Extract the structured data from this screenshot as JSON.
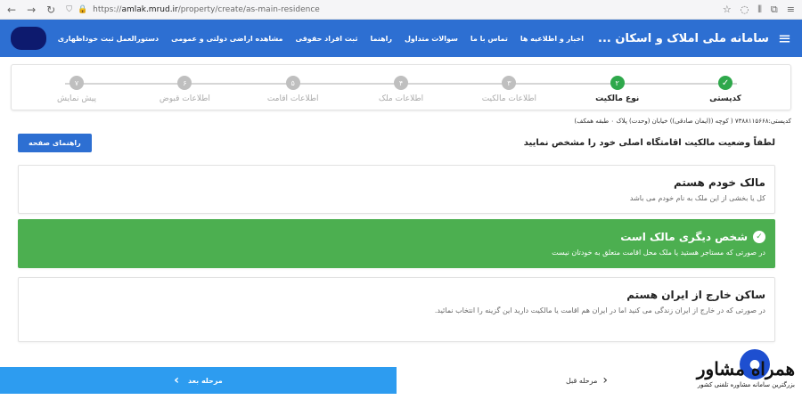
{
  "browser": {
    "url_prefix": "https://",
    "url_host": "amlak.mrud.ir",
    "url_path": "/property/create/as-main-residence"
  },
  "nav": {
    "title": "سامانه ملی املاک و اسکان ...",
    "links": [
      "اخبار و اطلاعیه ها",
      "تماس با ما",
      "سوالات متداول",
      "راهنما",
      "ثبت افراد حقوقی",
      "مشاهده اراضی دولتی و عمومی",
      "دستورالعمل ثبت خوداظهاری"
    ]
  },
  "stepper": {
    "steps": [
      {
        "num": "✓",
        "label": "کدپستی",
        "state": "done"
      },
      {
        "num": "۲",
        "label": "نوع مالکیت",
        "state": "active"
      },
      {
        "num": "۳",
        "label": "اطلاعات مالکیت",
        "state": "todo"
      },
      {
        "num": "۴",
        "label": "اطلاعات ملک",
        "state": "todo"
      },
      {
        "num": "۵",
        "label": "اطلاعات اقامت",
        "state": "todo"
      },
      {
        "num": "۶",
        "label": "اطلاعات قبوض",
        "state": "todo"
      },
      {
        "num": "۷",
        "label": "پیش نمایش",
        "state": "todo"
      }
    ]
  },
  "postal_line": "کدپستی:۷۳۸۸۱۱۵۶۶۸ ( کوچه ((ایمان صادقی)) خیابان (وحدت) پلاک ۰ طبقه همکف)",
  "question": "لطفاً وضعیت مالکیت اقامتگاه اصلی خود را مشخص نمایید",
  "help_button": "راهنمای صفحه",
  "options": [
    {
      "title": "مالک خودم هستم",
      "desc": "کل یا بخشی از این ملک به نام خودم می باشد",
      "selected": false
    },
    {
      "title": "شخص دیگری مالک است",
      "desc": "در صورتی که مستاجر هستید یا ملک محل اقامت متعلق به خودتان نیست",
      "selected": true
    },
    {
      "title": "ساکن خارج از ایران هستم",
      "desc": "در صورتی که در خارج از ایران زندگی می کنید اما در ایران هم اقامت یا مالکیت دارید این گزینه را انتخاب نمائید.",
      "selected": false
    }
  ],
  "buttons": {
    "next": "مرحله بعد",
    "prev": "مرحله قبل"
  },
  "brand": {
    "name": "همراه مشاور",
    "tagline": "بزرگترین سامانه مشاوره تلفنی کشور"
  },
  "colors": {
    "primary": "#2d6fd2",
    "selected": "#4caf50",
    "next": "#2d9cf0"
  }
}
